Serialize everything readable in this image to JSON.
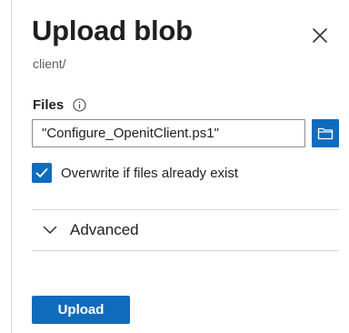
{
  "panel": {
    "title": "Upload blob",
    "subtitle": "client/",
    "close_icon": "close-icon"
  },
  "files": {
    "label": "Files",
    "info_icon": "info-icon",
    "value": "\"Configure_OpenitClient.ps1\"",
    "browse_icon": "folder-open-icon"
  },
  "overwrite": {
    "label": "Overwrite if files already exist",
    "checked": true
  },
  "advanced": {
    "label": "Advanced",
    "expanded": false,
    "chevron_icon": "chevron-down-icon"
  },
  "actions": {
    "upload_label": "Upload"
  },
  "colors": {
    "accent": "#0f6cbd",
    "border": "#d6d6d6",
    "text": "#1f1f1f"
  }
}
